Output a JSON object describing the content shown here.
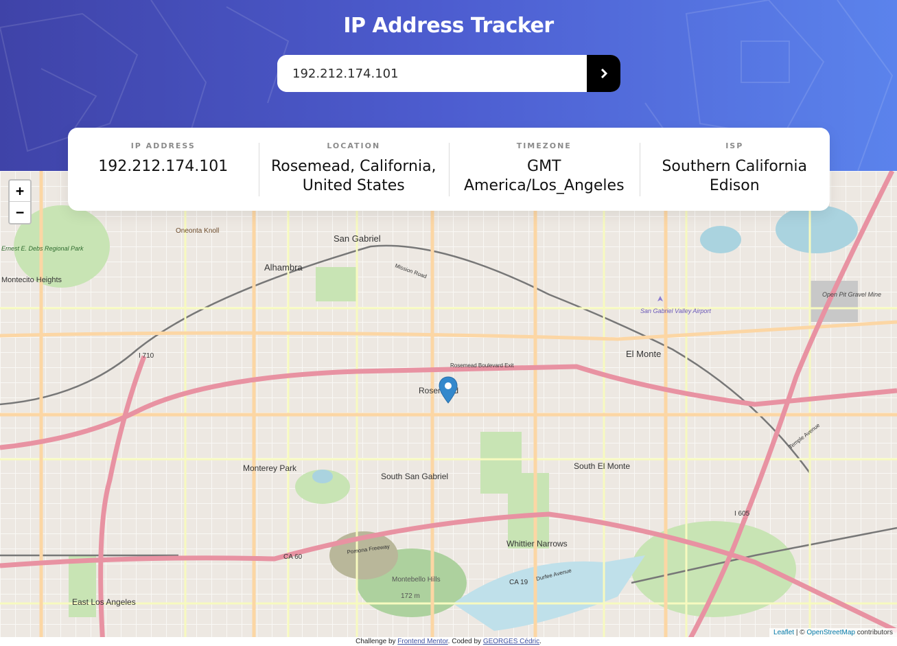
{
  "header": {
    "title": "IP Address Tracker",
    "search_value": "192.212.174.101",
    "submit_icon": "chevron-right-icon"
  },
  "info": {
    "ip": {
      "label": "IP ADDRESS",
      "value": "192.212.174.101"
    },
    "location": {
      "label": "LOCATION",
      "value": "Rosemead, California, United States"
    },
    "timezone": {
      "label": "TIMEZONE",
      "value": "GMT America/Los_Angeles"
    },
    "isp": {
      "label": "ISP",
      "value": "Southern California Edison"
    }
  },
  "map": {
    "zoom_in": "+",
    "zoom_out": "−",
    "places": {
      "san_gabriel": "San Gabriel",
      "alhambra": "Alhambra",
      "rosemead": "Rosemead",
      "el_monte": "El Monte",
      "monterey_park": "Monterey Park",
      "south_san_gabriel": "South San Gabriel",
      "south_el_monte": "South El Monte",
      "whittier_narrows": "Whittier Narrows",
      "east_los_angeles": "East Los Angeles",
      "montecito_heights": "Montecito Heights",
      "oneonta_knoll": "Oneonta Knoll",
      "montebello_hills": "Montebello Hills",
      "montebello_elev": "172 m",
      "ernest_debs": "Ernest E. Debs Regional Park",
      "airport": "San Gabriel Valley Airport",
      "open_pit": "Open Pit Gravel Mine"
    },
    "roads": {
      "i710": "I 710",
      "i605": "I 605",
      "ca60": "CA 60",
      "ca19": "CA 19",
      "mission_road": "Mission Road",
      "rosemead_exit": "Rosemead Boulevard Exit",
      "pomona_fwy": "Pomona Freeway",
      "durfee": "Durfee Avenue",
      "temple": "Temple Avenue"
    },
    "attribution": {
      "leaflet": "Leaflet",
      "sep": " | © ",
      "osm": "OpenStreetMap",
      "suffix": " contributors"
    },
    "marker_icon": "map-pin-icon",
    "accent": "#3388cc"
  },
  "footer": {
    "prefix": "Challenge by ",
    "fm": "Frontend Mentor",
    "mid": ". Coded by ",
    "author": "GEORGES Cédric",
    "end": "."
  }
}
